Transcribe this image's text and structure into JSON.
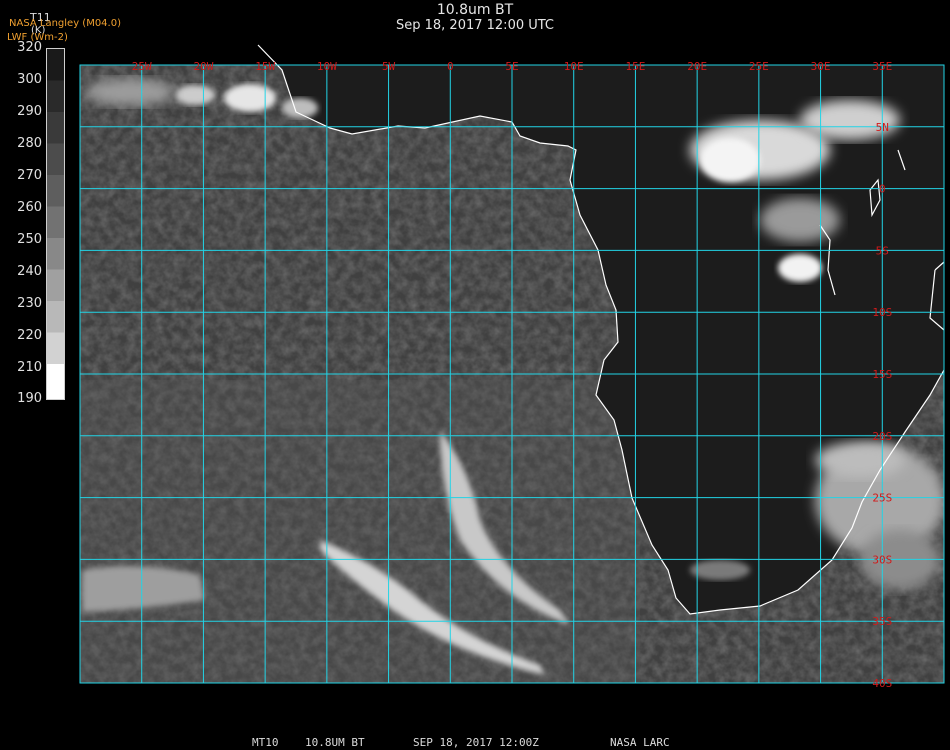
{
  "header": {
    "title": "10.8um BT",
    "subtitle": "Sep 18, 2017 12:00 UTC"
  },
  "colorbar": {
    "variable": "T11",
    "source": "NASA Langley (M04.0)",
    "unit": "(K)",
    "product": "LWF (Wm-2)",
    "ticks": [
      320,
      300,
      290,
      280,
      270,
      260,
      250,
      240,
      230,
      220,
      210,
      190
    ]
  },
  "map": {
    "lon_range": [
      -30,
      40
    ],
    "lat_range": [
      -40,
      10
    ],
    "lon_labels": [
      "25W",
      "20W",
      "15W",
      "10W",
      "5W",
      "0",
      "5E",
      "10E",
      "15E",
      "20E",
      "25E",
      "30E",
      "35E"
    ],
    "lat_labels": [
      "5N",
      "0",
      "5S",
      "10S",
      "15S",
      "20S",
      "25S",
      "30S",
      "35S",
      "40S"
    ],
    "grid_color": "#22d4e6",
    "label_color": "#d11a1a",
    "coast_color": "#ffffff"
  },
  "footer": {
    "satellite": "MT10",
    "channel": "10.8UM BT",
    "date": "SEP 18, 2017 12:00Z",
    "org": "NASA LARC"
  }
}
